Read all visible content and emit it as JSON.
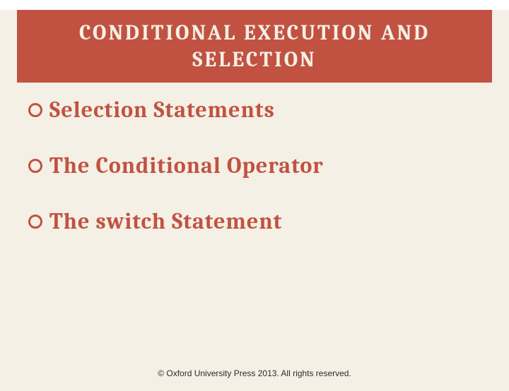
{
  "title": "CONDITIONAL EXECUTION AND SELECTION",
  "bullets": [
    "Selection Statements",
    "The Conditional Operator",
    "The switch Statement"
  ],
  "footer": "© Oxford University Press 2013. All rights reserved."
}
